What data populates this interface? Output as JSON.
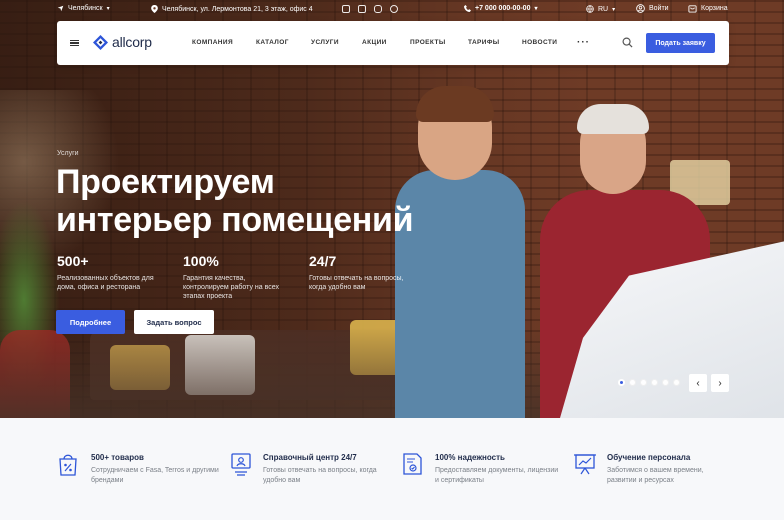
{
  "topbar": {
    "city": "Челябинск",
    "address": "Челябинск, ул. Лермонтова 21, 3 этаж, офис 4",
    "phone": "+7 000 000-00-00",
    "lang": "RU",
    "login": "Войти",
    "cart": "Корзина",
    "social_icons": [
      "vk-icon",
      "facebook-icon",
      "instagram-icon",
      "telegram-icon",
      "mail-icon"
    ]
  },
  "header": {
    "logo": "allcorp",
    "menu": [
      "КОМПАНИЯ",
      "КАТАЛОГ",
      "УСЛУГИ",
      "АКЦИИ",
      "ПРОЕКТЫ",
      "ТАРИФЫ",
      "НОВОСТИ"
    ],
    "more": "···",
    "cta": "Подать заявку"
  },
  "hero": {
    "breadcrumb": "Услуги",
    "title": "Проектируем интерьер помещений",
    "stats": [
      {
        "num": "500+",
        "desc": "Реализованных объектов для дома, офиса и ресторана"
      },
      {
        "num": "100%",
        "desc": "Гарантия качества, контролируем работу на всех этапах проекта"
      },
      {
        "num": "24/7",
        "desc": "Готовы отвечать на вопросы, когда удобно вам"
      }
    ],
    "btn_primary": "Подробнее",
    "btn_secondary": "Задать вопрос",
    "slides_total": 6,
    "slide_active": 1,
    "prev": "‹",
    "next": "›"
  },
  "features": [
    {
      "title": "500+ товаров",
      "desc": "Сотрудничаем с Fasa, Terros и другими брендами",
      "icon": "percent-bag-icon"
    },
    {
      "title": "Справочный центр 24/7",
      "desc": "Готовы отвечать на вопросы, когда удобно вам",
      "icon": "support-center-icon"
    },
    {
      "title": "100% надежность",
      "desc": "Предоставляем документы, лицензии и сертификаты",
      "icon": "certificate-icon"
    },
    {
      "title": "Обучение персонала",
      "desc": "Заботимся о вашем времени, развитии и ресурсах",
      "icon": "presentation-icon"
    }
  ],
  "colors": {
    "accent": "#3a5de0",
    "dark": "#1f2b4a"
  }
}
